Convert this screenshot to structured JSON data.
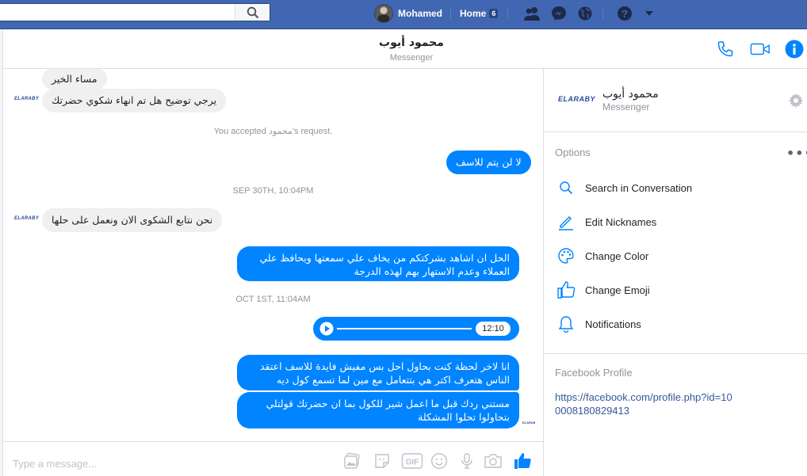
{
  "topbar": {
    "user_name": "Mohamed",
    "home_label": "Home",
    "home_badge": "6"
  },
  "conversation": {
    "title": "محمود أيوب",
    "subtitle": "Messenger"
  },
  "messages": {
    "m1": "مساء الخير",
    "m2": "يرجي توضيح هل تم انهاء شكوي حضرتك",
    "accepted": "You accepted محمود's request.",
    "m3": "لا لن يتم للاسف",
    "stamp1": "SEP 30TH, 10:04PM",
    "m4": "نحن نتابع الشكوى الان ونعمل على حلها",
    "m5": "الحل ان اشاهد بشركتكم من يخاف علي سمعتها ويحافظ علي العملاء وعدم الاستهار بهم لهذه الدرجة",
    "stamp2": "OCT 1ST, 11:04AM",
    "audio_time": "12:10",
    "m6": "انا لاخر لحظة كنت بحاول احل بس مفيش فايدة للاسف اعتقد الناس هتعرف اكتر هي بتتعامل مع مين لما تسمع كول ديه",
    "m7": "مستني ردك قبل ما اعمل شير للكول بما ان حضرتك قولتلي بتحاولوا تحلوا المشكلة",
    "sender_logo": "ELARABY"
  },
  "composer": {
    "placeholder": "Type a message..."
  },
  "right_panel": {
    "logo": "ELARABY",
    "name": "محمود أيوب",
    "subtitle": "Messenger",
    "options_title": "Options",
    "options_more": "•••",
    "options": [
      {
        "label": "Search in Conversation",
        "icon": "search-icon"
      },
      {
        "label": "Edit Nicknames",
        "icon": "pencil-icon"
      },
      {
        "label": "Change Color",
        "icon": "palette-icon"
      },
      {
        "label": "Change Emoji",
        "icon": "thumbs-up-icon"
      },
      {
        "label": "Notifications",
        "icon": "bell-icon"
      }
    ],
    "profile_title": "Facebook Profile",
    "profile_link": "https://facebook.com/profile.php?id=100008180829413"
  },
  "colors": {
    "topbar": "#4267b2",
    "messenger_blue": "#0084ff",
    "incoming_bubble": "#f1f0f0"
  }
}
